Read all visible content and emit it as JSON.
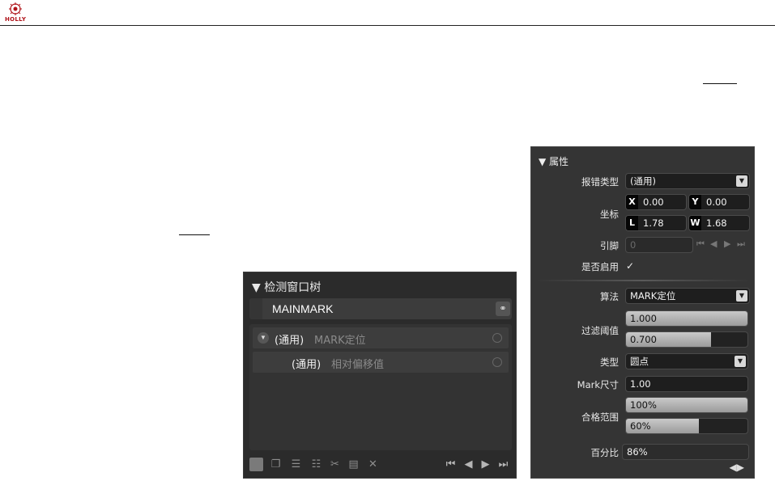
{
  "header": {
    "logo_text": "HOLLY"
  },
  "tree_panel": {
    "title": "▼ 检测窗口树",
    "root": {
      "name": "MAINMARK",
      "link_icon": "link-icon"
    },
    "rows": [
      {
        "kind": "(通用)",
        "algo": "MARK定位",
        "expanded": true
      },
      {
        "kind": "(通用)",
        "algo": "相对偏移值",
        "expanded": false
      }
    ],
    "toolbar": {
      "tools": [
        "add-window-icon",
        "copy-icon",
        "list-icon",
        "list-add-icon",
        "cut-icon",
        "paste-icon",
        "delete-icon"
      ],
      "nav": [
        "first-icon",
        "prev-icon",
        "next-icon",
        "last-icon"
      ]
    }
  },
  "properties": {
    "title": "▼ 属性",
    "error_type": {
      "label": "报错类型",
      "value": "(通用)"
    },
    "coords": {
      "label": "坐标",
      "x": {
        "tag": "X",
        "value": "0.00"
      },
      "y": {
        "tag": "Y",
        "value": "0.00"
      },
      "l": {
        "tag": "L",
        "value": "1.78"
      },
      "w": {
        "tag": "W",
        "value": "1.68"
      }
    },
    "pin": {
      "label": "引脚",
      "value": "0"
    },
    "enabled": {
      "label": "是否启用",
      "checked": true,
      "mark": "✓"
    },
    "algorithm": {
      "label": "算法",
      "value": "MARK定位"
    },
    "filter_threshold": {
      "label": "过滤阈值",
      "values": [
        "1.000",
        "0.700"
      ],
      "fill": [
        1.0,
        0.7
      ]
    },
    "type": {
      "label": "类型",
      "value": "圆点"
    },
    "mark_size": {
      "label": "Mark尺寸",
      "value": "1.00"
    },
    "pass_range": {
      "label": "合格范围",
      "values": [
        "100%",
        "60%"
      ],
      "fill": [
        1.0,
        0.6
      ]
    },
    "percentage": {
      "label": "百分比",
      "value": "86%"
    }
  }
}
